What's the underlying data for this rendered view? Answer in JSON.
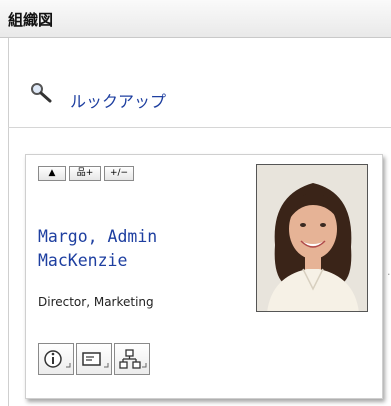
{
  "header": {
    "title": "組織図"
  },
  "lookup": {
    "label": "ルックアップ",
    "icon": "magnifier-icon"
  },
  "card": {
    "toolbar": {
      "up_label": "▲",
      "org_label": "品+",
      "expand_label": "+/−"
    },
    "name": "Margo, Admin MacKenzie",
    "job_title": "Director, Marketing",
    "actions": [
      {
        "icon": "info-icon"
      },
      {
        "icon": "contact-card-icon"
      },
      {
        "icon": "org-chart-icon"
      }
    ]
  },
  "colors": {
    "link": "#1e3fa0",
    "header_bg": "#ececec"
  }
}
